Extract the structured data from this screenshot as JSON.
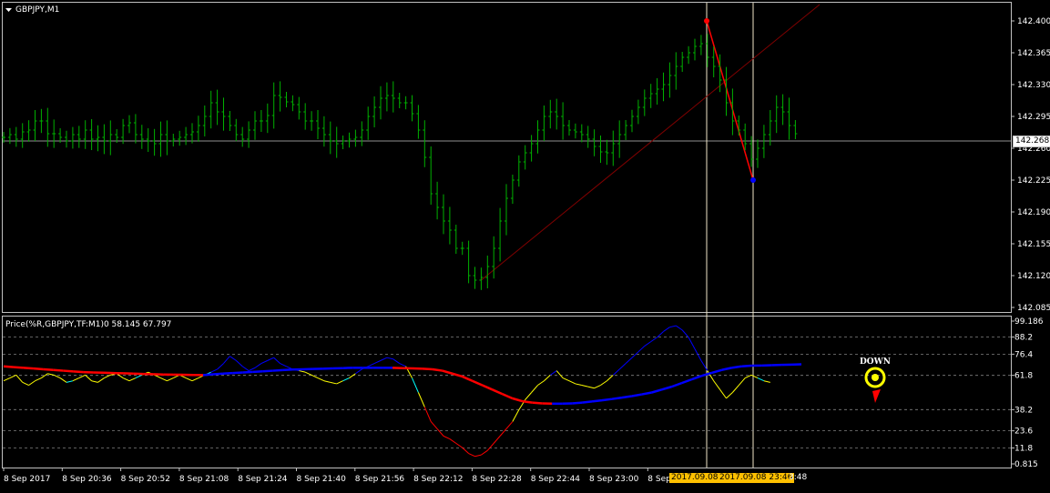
{
  "main_pane": {
    "symbol_label": "GBPJPY,M1",
    "price_ticks": [
      "142.400",
      "142.365",
      "142.330",
      "142.295",
      "142.260",
      "142.225",
      "142.190",
      "142.155",
      "142.120",
      "142.085"
    ],
    "current_price": "142.268"
  },
  "indicator_pane": {
    "label": "Price(%R,GBPJPY,TF:M1)0 58.145 67.797",
    "ticks": [
      "99.186",
      "88.2",
      "76.4",
      "61.8",
      "38.2",
      "23.6",
      "11.8",
      "0.815"
    ],
    "signal_text": "DOWN"
  },
  "time_axis": {
    "labels": [
      "8 Sep 2017",
      "8 Sep 20:36",
      "8 Sep 20:52",
      "8 Sep 21:08",
      "8 Sep 21:24",
      "8 Sep 21:40",
      "8 Sep 21:56",
      "8 Sep 22:12",
      "8 Sep 22:28",
      "8 Sep 22:44",
      "8 Sep 23:00",
      "8 Sep 23:"
    ],
    "tail_label": "3:48",
    "crosshair_labels": [
      "2017.09.08",
      "2017.09.08 23:46"
    ]
  },
  "colors": {
    "background": "#000000",
    "grid": "#c0c0c0",
    "candles": "#00b000",
    "wave_high": "#ff0000",
    "wave_low": "#0000ff",
    "trendline": "#800000",
    "ma_red": "#ff0000",
    "ma_blue": "#0000ff",
    "osc_up": "#0000ff",
    "osc_down": "#ff0000",
    "osc_neutral": "#ffff00",
    "osc_alt": "#00ffff",
    "signal": "#ffff00",
    "crosshair_tag": "#ffc000"
  },
  "chart_data": [
    {
      "type": "bar",
      "title": "GBPJPY,M1",
      "ylim": [
        142.085,
        142.4
      ],
      "close_series": [
        142.272,
        142.275,
        142.27,
        142.278,
        142.28,
        142.29,
        142.29,
        142.276,
        142.276,
        142.272,
        142.268,
        142.275,
        142.27,
        142.28,
        142.27,
        142.272,
        142.268,
        142.275,
        142.272,
        142.285,
        142.288,
        142.275,
        142.27,
        142.268,
        142.265,
        142.275,
        142.268,
        142.27,
        142.272,
        142.275,
        142.278,
        142.285,
        142.295,
        142.31,
        142.3,
        142.295,
        142.285,
        142.275,
        142.27,
        142.28,
        142.29,
        142.29,
        142.296,
        142.318,
        142.316,
        142.311,
        142.308,
        142.3,
        142.29,
        142.29,
        142.282,
        142.275,
        142.268,
        142.265,
        142.268,
        142.27,
        142.272,
        142.28,
        142.295,
        142.305,
        142.315,
        142.318,
        142.315,
        142.31,
        142.31,
        142.298,
        142.28,
        142.25,
        142.21,
        142.195,
        142.18,
        142.17,
        142.15,
        142.15,
        142.12,
        142.115,
        142.118,
        142.13,
        142.15,
        142.18,
        142.205,
        142.225,
        142.245,
        142.255,
        142.265,
        142.28,
        142.295,
        142.3,
        142.295,
        142.285,
        142.28,
        142.278,
        142.275,
        142.27,
        142.262,
        142.256,
        142.255,
        142.265,
        142.275,
        142.285,
        142.295,
        142.305,
        142.315,
        142.32,
        142.325,
        142.33,
        142.34,
        142.35,
        142.36,
        142.365,
        142.372,
        142.375,
        142.36,
        142.35,
        142.335,
        142.31,
        142.29,
        142.28,
        142.265,
        142.248,
        142.26,
        142.275,
        142.29,
        142.305,
        142.3,
        142.285,
        142.276
      ]
    },
    {
      "type": "line",
      "title": "Price(%R,GBPJPY,TF:M1)0 58.145 67.797",
      "ylim": [
        0.815,
        99.186
      ],
      "series": [
        {
          "values": [
            58,
            60,
            62,
            57,
            55,
            58,
            60,
            63,
            62,
            60,
            57,
            58,
            60,
            62,
            58,
            57,
            60,
            62,
            63,
            60,
            58,
            60,
            62,
            64,
            62,
            60,
            58,
            60,
            62,
            60,
            58,
            60,
            62,
            64,
            66,
            70,
            75,
            72,
            68,
            65,
            67,
            70,
            72,
            74,
            70,
            68,
            66,
            65,
            64,
            62,
            60,
            58,
            57,
            56,
            58,
            60,
            63,
            66,
            68,
            70,
            72,
            74,
            73,
            70,
            68,
            60,
            50,
            40,
            30,
            25,
            20,
            18,
            15,
            12,
            8,
            6,
            7,
            10,
            15,
            20,
            25,
            30,
            38,
            45,
            50,
            55,
            58,
            62,
            65,
            60,
            58,
            56,
            55,
            54,
            53,
            55,
            58,
            62,
            66,
            70,
            74,
            78,
            82,
            85,
            88,
            92,
            95,
            96,
            93,
            88,
            80,
            72,
            65,
            58,
            52,
            46,
            50,
            55,
            60,
            62,
            60,
            58,
            57
          ]
        },
        {
          "values": [
            68,
            67.5,
            67,
            66.5,
            66,
            65.5,
            65,
            64.5,
            64,
            63.8,
            63.6,
            63.4,
            63.2,
            63,
            62.8,
            62.6,
            62.4,
            62.3,
            62.2,
            62.1,
            62,
            62.5,
            63,
            63.4,
            63.8,
            64.2,
            64.6,
            65,
            65.4,
            65.8,
            66,
            66.2,
            66.4,
            66.6,
            66.8,
            67,
            67,
            67,
            67,
            67,
            66.8,
            66.6,
            66.4,
            66,
            65,
            63,
            61,
            58,
            55,
            52,
            49,
            46,
            44,
            43,
            42.5,
            42.3,
            42.3,
            42.5,
            43,
            43.8,
            44.6,
            45.5,
            46.5,
            47.5,
            48.7,
            50,
            52,
            54,
            56.5,
            59,
            61.5,
            63.5,
            65.5,
            67,
            68,
            68.5,
            68.6,
            68.8,
            69,
            69.2,
            69.4
          ]
        }
      ]
    }
  ]
}
